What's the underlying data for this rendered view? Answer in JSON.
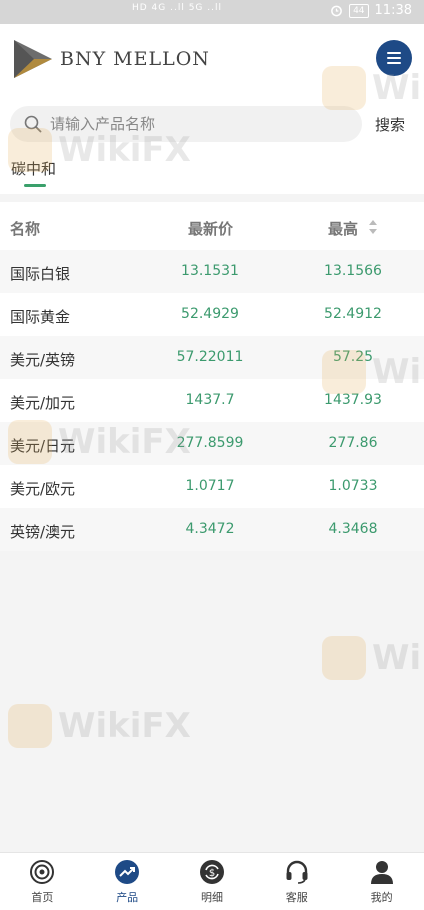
{
  "status_bar": {
    "signals": "HD 4G ..ll 5G ..ll",
    "battery": "44",
    "time": "11:38"
  },
  "header": {
    "brand": "BNY MELLON",
    "logo_colors": [
      "#6d6d6d",
      "#b08a3e"
    ],
    "menu_color": "#1e4a86"
  },
  "search": {
    "placeholder": "请输入产品名称",
    "value": "",
    "button_label": "搜索"
  },
  "category_tab": {
    "label": "碳中和",
    "indicator_color": "#3aa06b"
  },
  "table": {
    "headers": {
      "name": "名称",
      "latest": "最新价",
      "high": "最高"
    },
    "value_color": "#3c9a6e",
    "rows": [
      {
        "name": "国际白银",
        "latest": "13.1531",
        "high": "13.1566"
      },
      {
        "name": "国际黄金",
        "latest": "52.4929",
        "high": "52.4912"
      },
      {
        "name": "美元/英镑",
        "latest": "57.22011",
        "high": "57.25"
      },
      {
        "name": "美元/加元",
        "latest": "1437.7",
        "high": "1437.93"
      },
      {
        "name": "美元/日元",
        "latest": "277.8599",
        "high": "277.86"
      },
      {
        "name": "美元/欧元",
        "latest": "1.0717",
        "high": "1.0733"
      },
      {
        "name": "英镑/澳元",
        "latest": "4.3472",
        "high": "4.3468"
      }
    ]
  },
  "watermark": {
    "text": "WikiFX",
    "color": "#e6b05a"
  },
  "bottom_nav": {
    "items": [
      {
        "label": "首页",
        "icon": "home-target-icon"
      },
      {
        "label": "产品",
        "icon": "trend-chart-icon"
      },
      {
        "label": "明细",
        "icon": "dollar-refresh-icon"
      },
      {
        "label": "客服",
        "icon": "headset-icon"
      },
      {
        "label": "我的",
        "icon": "user-icon"
      }
    ],
    "active_color": "#1e4a86"
  }
}
